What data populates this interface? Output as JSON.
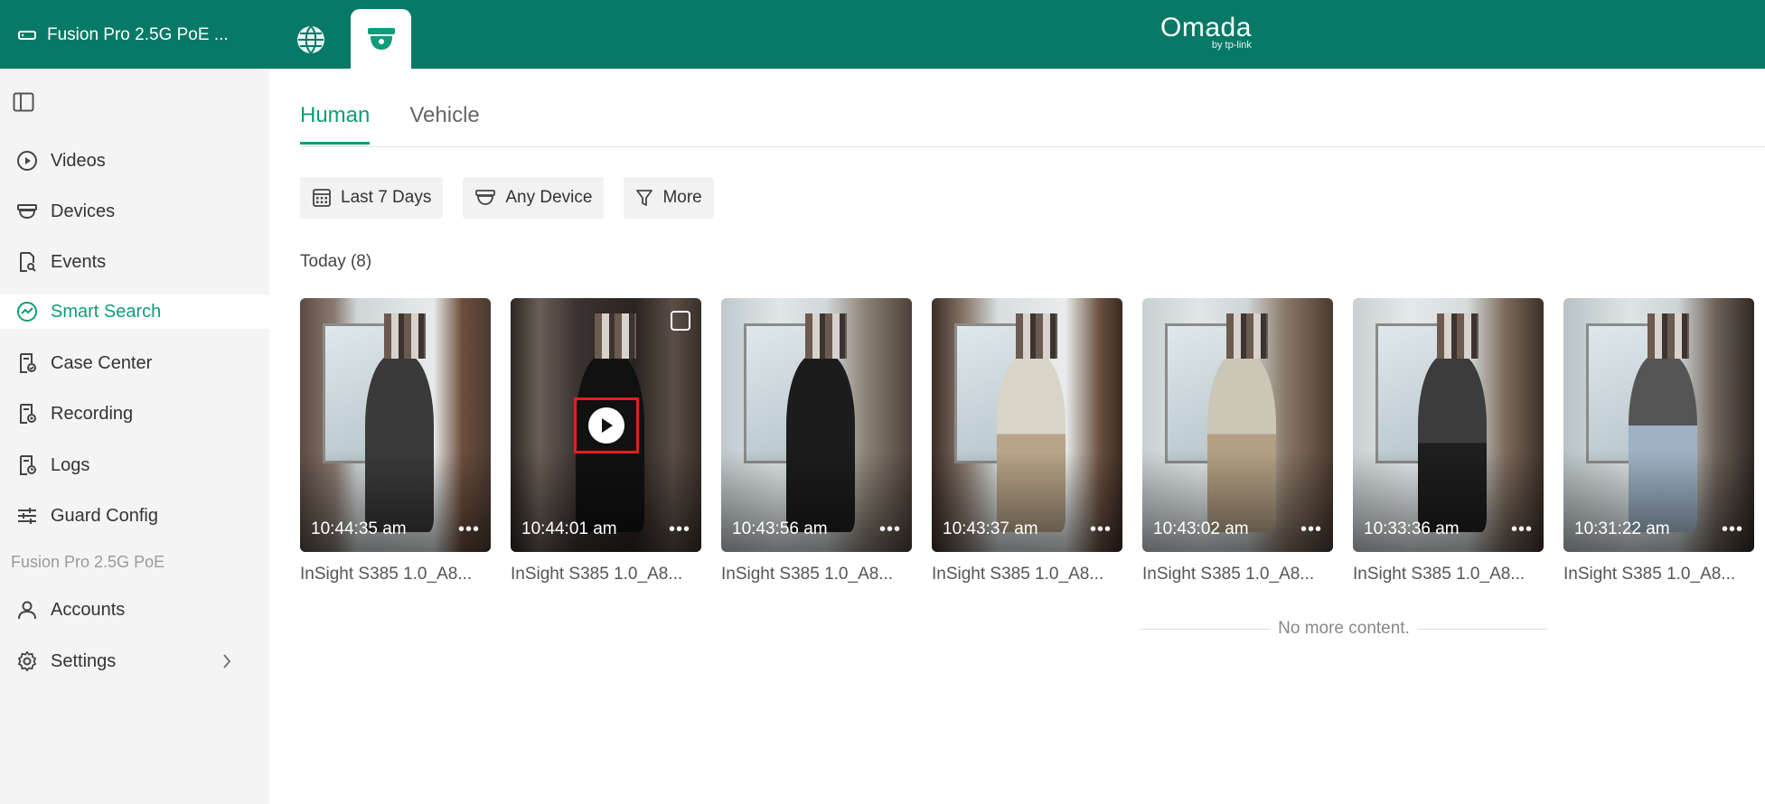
{
  "header": {
    "site_name": "Fusion Pro 2.5G PoE ...",
    "logo_brand": "Omada",
    "logo_sub": "by tp-link"
  },
  "sidebar": {
    "items": [
      {
        "label": "Videos",
        "icon": "play-circle-icon"
      },
      {
        "label": "Devices",
        "icon": "camera-icon"
      },
      {
        "label": "Events",
        "icon": "event-search-icon"
      },
      {
        "label": "Smart Search",
        "icon": "smart-search-icon",
        "active": true
      },
      {
        "label": "Case Center",
        "icon": "case-icon"
      },
      {
        "label": "Recording",
        "icon": "recording-icon"
      },
      {
        "label": "Logs",
        "icon": "logs-icon"
      },
      {
        "label": "Guard Config",
        "icon": "sliders-icon"
      }
    ],
    "group_label": "Fusion Pro 2.5G PoE",
    "group_items": [
      {
        "label": "Accounts",
        "icon": "user-icon"
      },
      {
        "label": "Settings",
        "icon": "gear-icon"
      }
    ]
  },
  "main": {
    "tabs": [
      {
        "label": "Human",
        "active": true
      },
      {
        "label": "Vehicle",
        "active": false
      }
    ],
    "filters": [
      {
        "label": "Last 7 Days",
        "icon": "calendar-icon"
      },
      {
        "label": "Any Device",
        "icon": "camera-icon"
      },
      {
        "label": "More",
        "icon": "filter-icon"
      }
    ],
    "day_label": "Today",
    "day_count": "(8)",
    "cards": [
      {
        "time": "10:44:35 am",
        "device": "InSight S385 1.0_A8..."
      },
      {
        "time": "10:44:01 am",
        "device": "InSight S385 1.0_A8..."
      },
      {
        "time": "10:43:56 am",
        "device": "InSight S385 1.0_A8..."
      },
      {
        "time": "10:43:37 am",
        "device": "InSight S385 1.0_A8..."
      },
      {
        "time": "10:43:02 am",
        "device": "InSight S385 1.0_A8..."
      },
      {
        "time": "10:33:36 am",
        "device": "InSight S385 1.0_A8..."
      },
      {
        "time": "10:31:22 am",
        "device": "InSight S385 1.0_A8..."
      }
    ],
    "no_more": "No more content."
  },
  "colors": {
    "topbar": "#077a67",
    "accent": "#0f9d7a",
    "sidebar_bg": "#f4f4f4",
    "highlight": "#e02020"
  }
}
